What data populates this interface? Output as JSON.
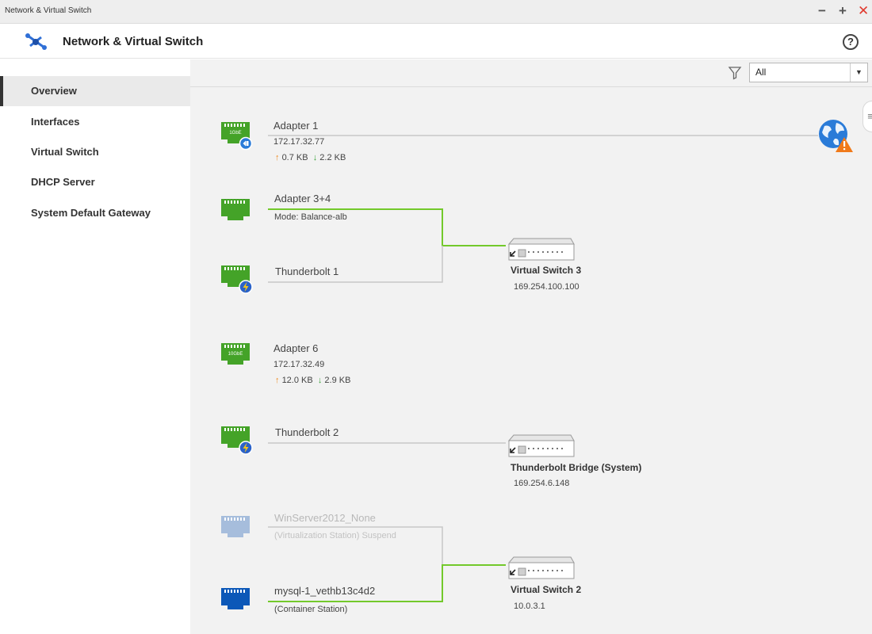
{
  "window": {
    "title": "Network & Virtual Switch",
    "controls": {
      "minimize": "−",
      "maximize": "+",
      "close": "✕"
    }
  },
  "header": {
    "title": "Network & Virtual Switch",
    "help": "?"
  },
  "sidebar": {
    "items": [
      {
        "label": "Overview",
        "active": true
      },
      {
        "label": "Interfaces"
      },
      {
        "label": "Virtual Switch"
      },
      {
        "label": "DHCP Server"
      },
      {
        "label": "System Default Gateway"
      }
    ]
  },
  "toolbar": {
    "filter_value": "All",
    "filter_arrow": "▼"
  },
  "side_toggle": "≡",
  "colors": {
    "adapter_green": "#44a328",
    "connected_line": "#73c92b",
    "idle_line": "#c8c8c8",
    "vm_blue": "#0c58b8",
    "dim_blue": "#a6bddc",
    "upload_orange": "#ee8a1f",
    "download_green": "#3aa33a"
  },
  "adapters": [
    {
      "name": "Adapter 1",
      "ip": "172.17.32.77",
      "up": "0.7 KB",
      "down": "2.2 KB",
      "badge_text": "1GbE",
      "badge": "link"
    },
    {
      "name": "Adapter 3+4",
      "mode": "Mode: Balance-alb"
    },
    {
      "name": "Thunderbolt 1",
      "badge": "thunderbolt"
    },
    {
      "name": "Adapter 6",
      "ip": "172.17.32.49",
      "up": "12.0 KB",
      "down": "2.9 KB",
      "badge_text": "10GbE"
    },
    {
      "name": "Thunderbolt 2",
      "badge": "thunderbolt"
    },
    {
      "name": "WinServer2012_None",
      "sub": "(Virtualization Station) Suspend",
      "state": "suspended"
    },
    {
      "name": "mysql-1_vethb13c4d2",
      "sub": "(Container Station)"
    }
  ],
  "up_arrow": "↑",
  "down_arrow": "↓",
  "switches": [
    {
      "name": "Virtual Switch 3",
      "ip": "169.254.100.100"
    },
    {
      "name": "Thunderbolt Bridge (System)",
      "ip": "169.254.6.148"
    },
    {
      "name": "Virtual Switch 2",
      "ip": "10.0.3.1"
    }
  ],
  "internet": {
    "icon": "globe-warning-icon"
  }
}
